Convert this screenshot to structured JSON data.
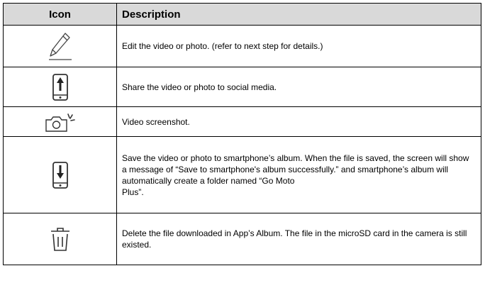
{
  "table": {
    "headers": {
      "icon": "Icon",
      "description": "Description"
    },
    "rows": [
      {
        "icon": "edit-pencil-icon",
        "description": "Edit the video or photo. (refer to next step for details.)"
      },
      {
        "icon": "share-phone-icon",
        "description": "Share the video or photo to social media."
      },
      {
        "icon": "camera-screenshot-icon",
        "description": "Video screenshot."
      },
      {
        "icon": "save-to-phone-icon",
        "description": "Save the video or photo to smartphone’s album. When the file is saved, the screen will show a message of “Save to smartphone's album successfully.” and smartphone’s album will automatically create a folder named “Go Moto\nPlus”."
      },
      {
        "icon": "trash-icon",
        "description": "Delete the file downloaded in App’s Album. The file in the microSD card in the camera is still existed."
      }
    ]
  }
}
